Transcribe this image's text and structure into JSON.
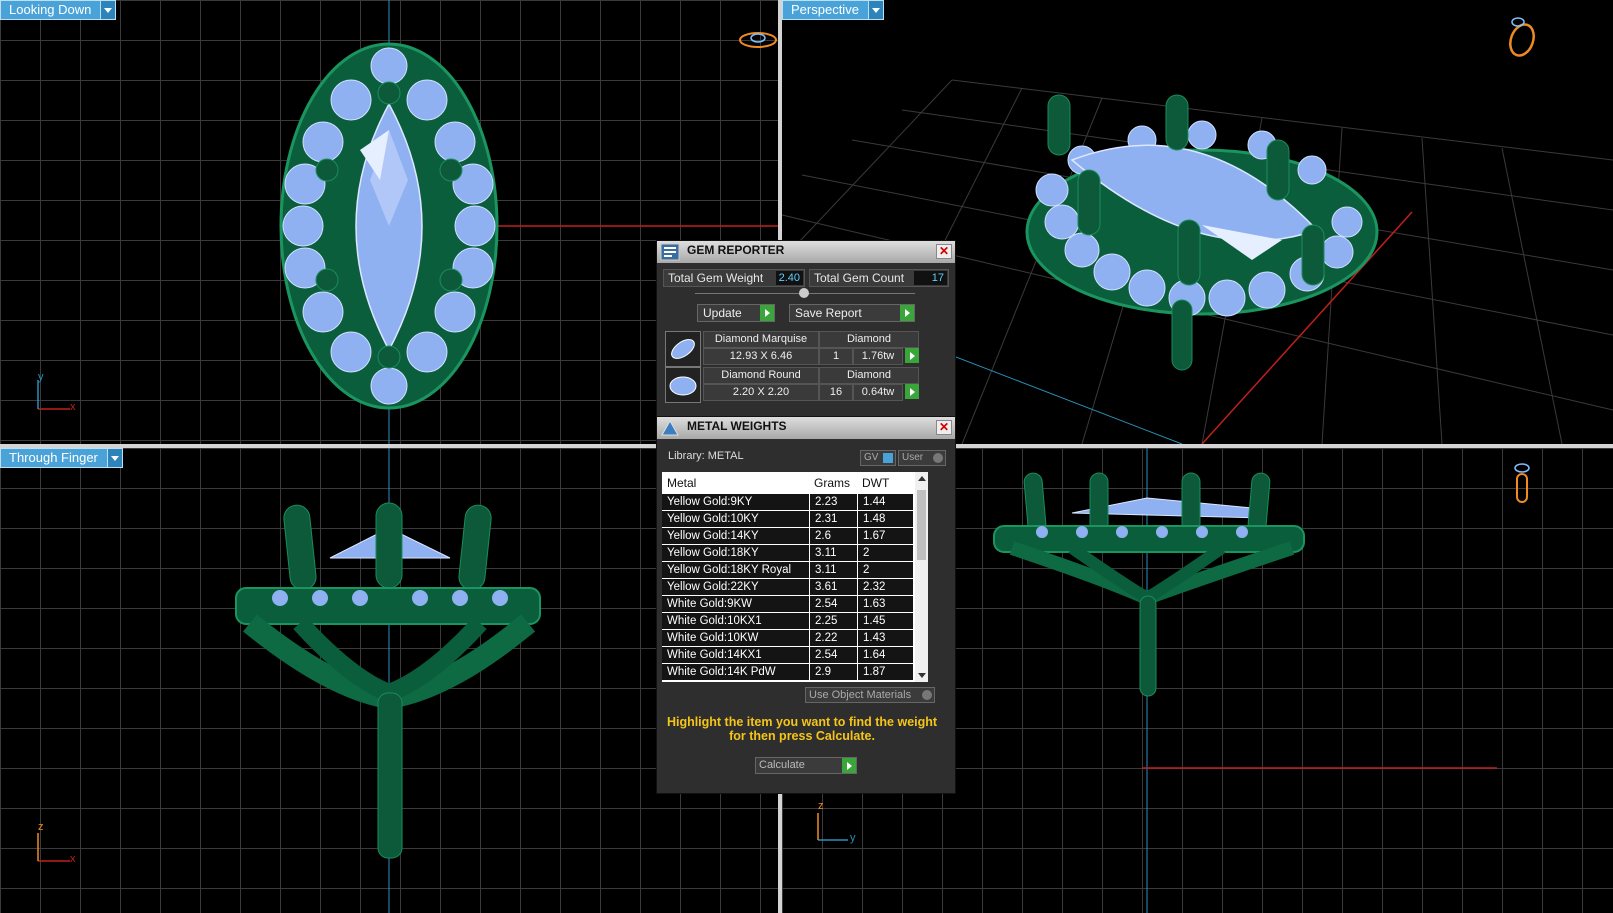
{
  "viewports": {
    "top_left": {
      "label": "Looking Down",
      "axis_x": "x",
      "axis_y": "y"
    },
    "top_right": {
      "label": "Perspective"
    },
    "bottom_left": {
      "label": "Through Finger",
      "axis_x": "x",
      "axis_y": "z"
    },
    "bottom_right": {
      "label": "",
      "axis_x": "y",
      "axis_y": "z"
    }
  },
  "gem_reporter": {
    "title": "GEM REPORTER",
    "total_gem_weight_label": "Total Gem Weight",
    "total_gem_weight": "2.40",
    "total_gem_count_label": "Total Gem Count",
    "total_gem_count": "17",
    "update_label": "Update",
    "save_report_label": "Save Report",
    "gems": [
      {
        "name": "Diamond Marquise",
        "type": "Diamond",
        "size": "12.93 X 6.46",
        "count": "1",
        "weight": "1.76tw"
      },
      {
        "name": "Diamond Round",
        "type": "Diamond",
        "size": "2.20 X 2.20",
        "count": "16",
        "weight": "0.64tw"
      }
    ]
  },
  "metal_weights": {
    "title": "METAL WEIGHTS",
    "library_label": "Library: METAL",
    "gv_label": "GV",
    "user_label": "User",
    "columns": [
      "Metal",
      "Grams",
      "DWT"
    ],
    "rows": [
      {
        "metal": "Yellow Gold:9KY",
        "grams": "2.23",
        "dwt": "1.44"
      },
      {
        "metal": "Yellow Gold:10KY",
        "grams": "2.31",
        "dwt": "1.48"
      },
      {
        "metal": "Yellow Gold:14KY",
        "grams": "2.6",
        "dwt": "1.67"
      },
      {
        "metal": "Yellow Gold:18KY",
        "grams": "3.11",
        "dwt": "2"
      },
      {
        "metal": "Yellow Gold:18KY Royal",
        "grams": "3.11",
        "dwt": "2"
      },
      {
        "metal": "Yellow Gold:22KY",
        "grams": "3.61",
        "dwt": "2.32"
      },
      {
        "metal": "White Gold:9KW",
        "grams": "2.54",
        "dwt": "1.63"
      },
      {
        "metal": "White Gold:10KX1",
        "grams": "2.25",
        "dwt": "1.45"
      },
      {
        "metal": "White Gold:10KW",
        "grams": "2.22",
        "dwt": "1.43"
      },
      {
        "metal": "White Gold:14KX1",
        "grams": "2.54",
        "dwt": "1.64"
      },
      {
        "metal": "White Gold:14K PdW",
        "grams": "2.9",
        "dwt": "1.87"
      }
    ],
    "use_object_materials_label": "Use Object Materials",
    "hint_line1": "Highlight the item you want to find the weight",
    "hint_line2": "for then press Calculate.",
    "calculate_label": "Calculate"
  },
  "colors": {
    "metal_green": "#0f6b45",
    "gem_blue": "#8fb1f2",
    "viewport_label": "#4aa3d8",
    "hint_yellow": "#f5c518"
  }
}
